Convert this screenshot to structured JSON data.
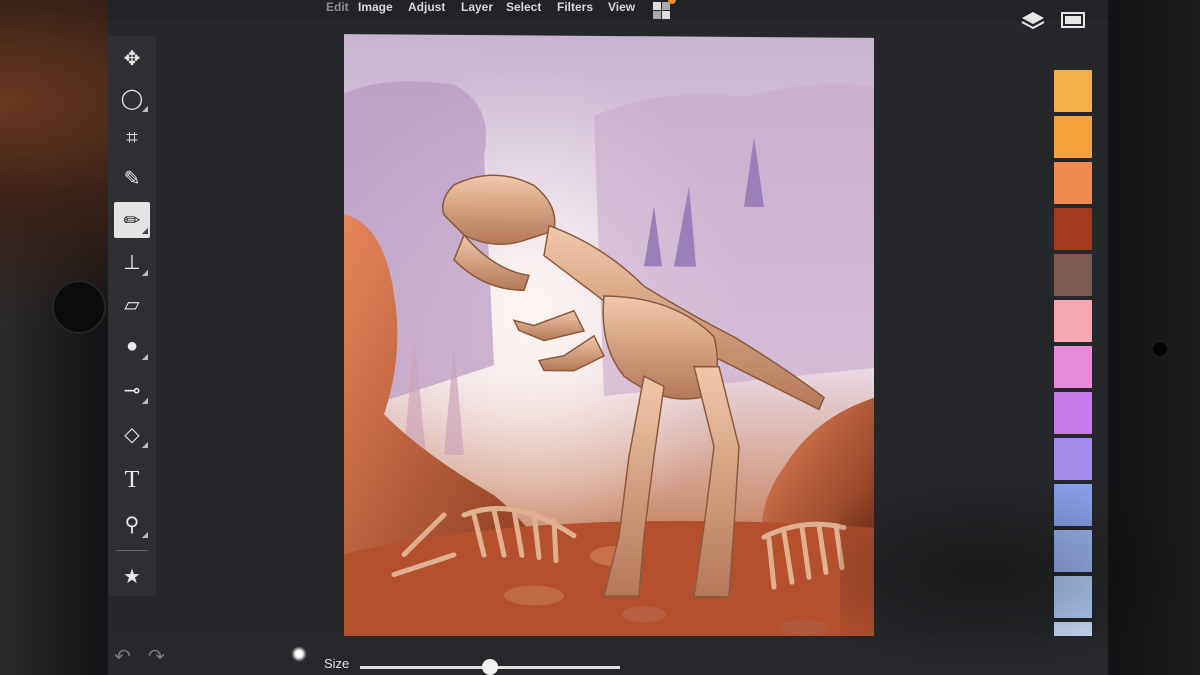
{
  "menu": {
    "items": [
      "Edit",
      "Image",
      "Adjust",
      "Layer",
      "Select",
      "Filters",
      "View"
    ]
  },
  "toolbar": {
    "tools": [
      {
        "icon": "move-icon",
        "glyph": "✥"
      },
      {
        "icon": "lasso-icon",
        "glyph": "◯"
      },
      {
        "icon": "crop-icon",
        "glyph": "⌗"
      },
      {
        "icon": "eyedropper-icon",
        "glyph": "✎"
      },
      {
        "icon": "brush-icon",
        "glyph": "✏",
        "active": true
      },
      {
        "icon": "stamp-icon",
        "glyph": "⊥"
      },
      {
        "icon": "eraser-icon",
        "glyph": "▱"
      },
      {
        "icon": "blur-drop-icon",
        "glyph": "●"
      },
      {
        "icon": "smudge-icon",
        "glyph": "⊸"
      },
      {
        "icon": "fill-bucket-icon",
        "glyph": "◇"
      },
      {
        "icon": "text-icon",
        "glyph": "T"
      },
      {
        "icon": "zoom-icon",
        "glyph": "⚲"
      },
      {
        "icon": "favorites-star-icon",
        "glyph": "★"
      }
    ]
  },
  "swatches": [
    "#f4b04a",
    "#f3a23c",
    "#f08a4e",
    "#a43a1e",
    "#7a5a52",
    "#f3a7b3",
    "#e88ad8",
    "#c77be8",
    "#a48bea",
    "#8aa0ec",
    "#9cb4f0",
    "#b4cdf6",
    "#c8dcf8"
  ],
  "bottombar": {
    "size_label": "Size",
    "size_value": 0.5
  },
  "top_right": {
    "layers_icon": "layers-icon",
    "fullscreen_icon": "fullscreen-icon"
  }
}
